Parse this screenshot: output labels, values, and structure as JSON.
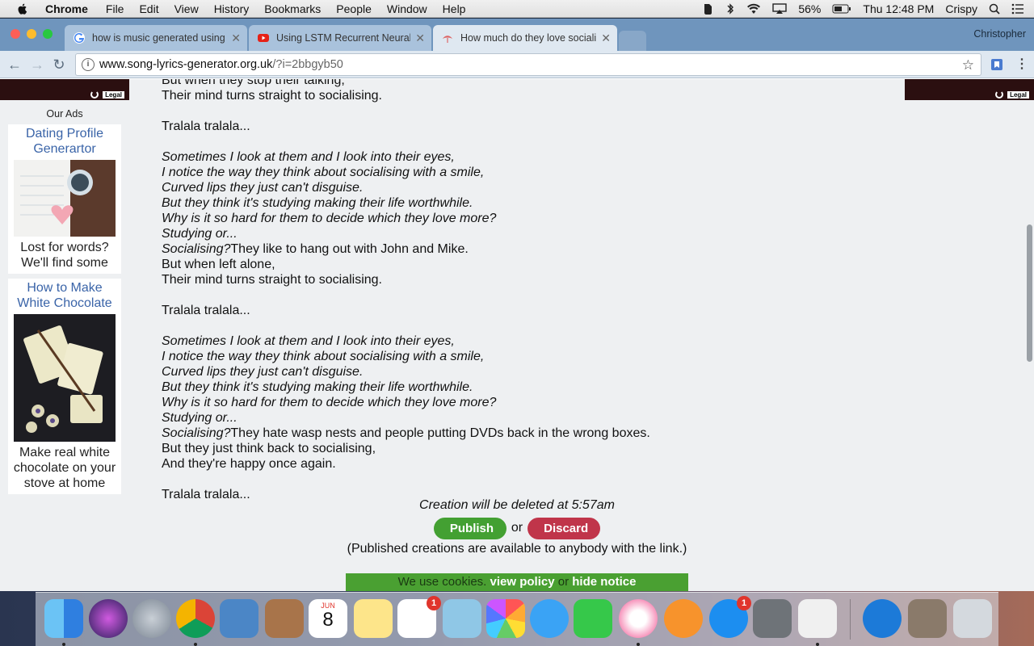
{
  "menubar": {
    "app": "Chrome",
    "items": [
      "File",
      "Edit",
      "View",
      "History",
      "Bookmarks",
      "People",
      "Window",
      "Help"
    ],
    "battery": "56%",
    "clock": "Thu 12:48 PM",
    "user": "Crispy"
  },
  "browser": {
    "tabs": [
      {
        "title": "how is music generated using",
        "icon": "google-icon"
      },
      {
        "title": "Using LSTM Recurrent Neural",
        "icon": "youtube-icon"
      },
      {
        "title": "How much do they love sociali",
        "icon": "song-generator-icon"
      }
    ],
    "profile": "Christopher",
    "url_host": "www.song-lyrics-generator.org.uk",
    "url_path": "/?i=2bbgyb50"
  },
  "ads": {
    "legal": "Legal",
    "heading": "Our Ads",
    "cards": [
      {
        "title": "Dating Profile Generartor",
        "text": "Lost for words? We'll find some"
      },
      {
        "title": "How to Make White Chocolate",
        "text": "Make real white chocolate on your stove at home"
      }
    ]
  },
  "lyrics": {
    "lines": [
      {
        "text": "But when they stop their talking,",
        "italic": false
      },
      {
        "text": "Their mind turns straight to socialising.",
        "italic": false
      },
      {
        "text": "",
        "italic": false
      },
      {
        "text": "Tralala tralala...",
        "italic": false
      },
      {
        "text": "",
        "italic": false
      },
      {
        "text": "Sometimes I look at them and I look into their eyes,",
        "italic": true
      },
      {
        "text": "I notice the way they think about socialising with a smile,",
        "italic": true
      },
      {
        "text": "Curved lips they just can't disguise.",
        "italic": true
      },
      {
        "text": "But they think it's studying making their life worthwhile.",
        "italic": true
      },
      {
        "text": "Why is it so hard for them to decide which they love more?",
        "italic": true
      },
      {
        "text": "Studying or...",
        "italic": true
      },
      {
        "text": "Socialising?",
        "italic": true,
        "rest": "They like to hang out with John and Mike."
      },
      {
        "text": "But when left alone,",
        "italic": false
      },
      {
        "text": "Their mind turns straight to socialising.",
        "italic": false
      },
      {
        "text": "",
        "italic": false
      },
      {
        "text": "Tralala tralala...",
        "italic": false
      },
      {
        "text": "",
        "italic": false
      },
      {
        "text": "Sometimes I look at them and I look into their eyes,",
        "italic": true
      },
      {
        "text": "I notice the way they think about socialising with a smile,",
        "italic": true
      },
      {
        "text": "Curved lips they just can't disguise.",
        "italic": true
      },
      {
        "text": "But they think it's studying making their life worthwhile.",
        "italic": true
      },
      {
        "text": "Why is it so hard for them to decide which they love more?",
        "italic": true
      },
      {
        "text": "Studying or...",
        "italic": true
      },
      {
        "text": "Socialising?",
        "italic": true,
        "rest": "They hate wasp nests and people putting DVDs back in the wrong boxes."
      },
      {
        "text": "But they just think back to socialising,",
        "italic": false
      },
      {
        "text": "And they're happy once again.",
        "italic": false
      },
      {
        "text": "",
        "italic": false
      },
      {
        "text": "Tralala tralala...",
        "italic": false
      }
    ]
  },
  "footer": {
    "deleted_note": "Creation will be deleted at 5:57am",
    "publish": "Publish",
    "or": "or",
    "discard": "Discard",
    "published_note": "(Published creations are available to anybody with the link.)"
  },
  "cookie": {
    "text": "We use cookies.",
    "view_policy": "view policy",
    "or": "or",
    "hide_notice": "hide notice"
  },
  "dock": {
    "calendar_month": "JUN",
    "calendar_day": "8",
    "reminders_badge": "1",
    "appstore_badge": "1"
  }
}
